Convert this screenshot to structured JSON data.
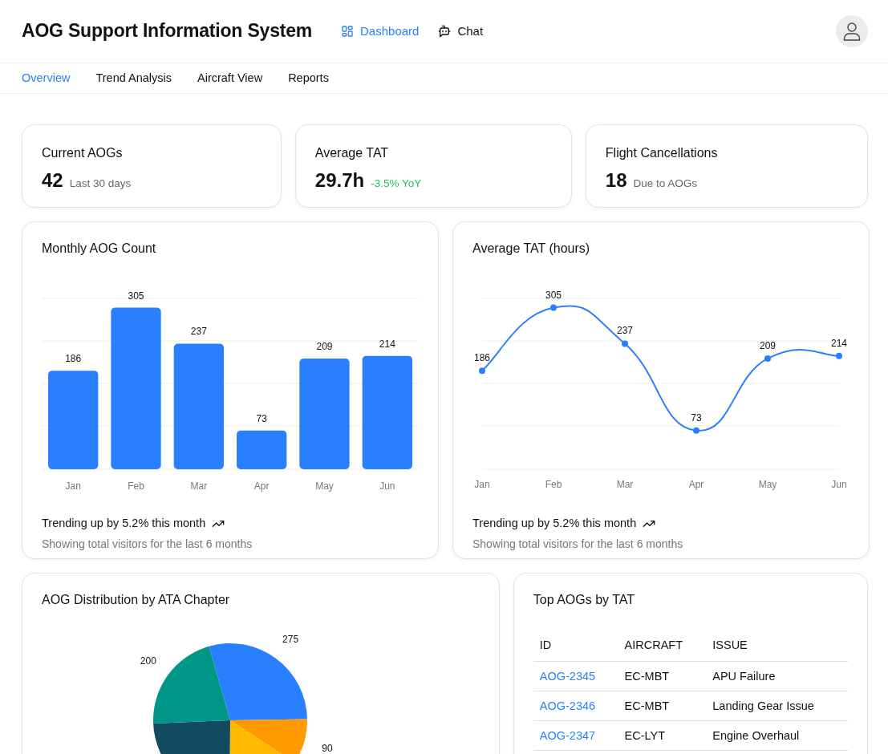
{
  "header": {
    "title": "AOG Support Information System",
    "nav": [
      {
        "label": "Dashboard",
        "selected": true
      },
      {
        "label": "Chat",
        "selected": false
      }
    ]
  },
  "tabs": [
    {
      "label": "Overview",
      "selected": true
    },
    {
      "label": "Trend Analysis",
      "selected": false
    },
    {
      "label": "Aircraft View",
      "selected": false
    },
    {
      "label": "Reports",
      "selected": false
    }
  ],
  "stats": [
    {
      "title": "Current AOGs",
      "value": "42",
      "note": "Last 30 days",
      "positive": false
    },
    {
      "title": "Average TAT",
      "value": "29.7h",
      "note": "-3.5% YoY",
      "positive": true
    },
    {
      "title": "Flight Cancellations",
      "value": "18",
      "note": "Due to AOGs",
      "positive": false
    }
  ],
  "charts": [
    {
      "title": "Monthly AOG Count",
      "trend": "Trending up by 5.2% this month",
      "caption": "Showing total visitors for the last 6 months",
      "chart_data": {
        "type": "bar",
        "categories": [
          "Jan",
          "Feb",
          "Mar",
          "Apr",
          "May",
          "Jun"
        ],
        "series": [
          {
            "color": "#2a7fff",
            "values": [
              186,
              305,
              237,
              73,
              209,
              214
            ]
          }
        ],
        "data_labels": true
      }
    },
    {
      "title": "Average TAT (hours)",
      "trend": "Trending up by 5.2% this month",
      "caption": "Showing total visitors for the last 6 months",
      "chart_data": {
        "type": "line",
        "categories": [
          "Jan",
          "Feb",
          "Mar",
          "Apr",
          "May",
          "Jun"
        ],
        "series": [
          {
            "color": "#2a7fff",
            "marker": "circle",
            "values": [
              186,
              305,
              237,
              73,
              209,
              214
            ]
          }
        ],
        "data_labels": true
      }
    }
  ],
  "distribution": {
    "title": "AOG Distribution by ATA Chapter",
    "chart_data": {
      "type": "pie",
      "series": [
        {
          "values": [
            29.2,
            9.5,
            15.9,
            24.2,
            21.2
          ]
        }
      ],
      "colors": [
        "#2a7fff",
        "#ff9900",
        "#ffbb00",
        "#124b5f",
        "#009688"
      ],
      "value_labels": [
        "275",
        "90",
        null,
        null,
        "200"
      ]
    }
  },
  "top_aogs": {
    "title": "Top AOGs by TAT",
    "columns": [
      "ID",
      "AIRCRAFT",
      "ISSUE"
    ],
    "rows": [
      [
        "AOG-2345",
        "EC-MBT",
        "APU Failure"
      ],
      [
        "AOG-2346",
        "EC-MBT",
        "Landing Gear Issue"
      ],
      [
        "AOG-2347",
        "EC-LYT",
        "Engine Overhaul"
      ]
    ]
  }
}
